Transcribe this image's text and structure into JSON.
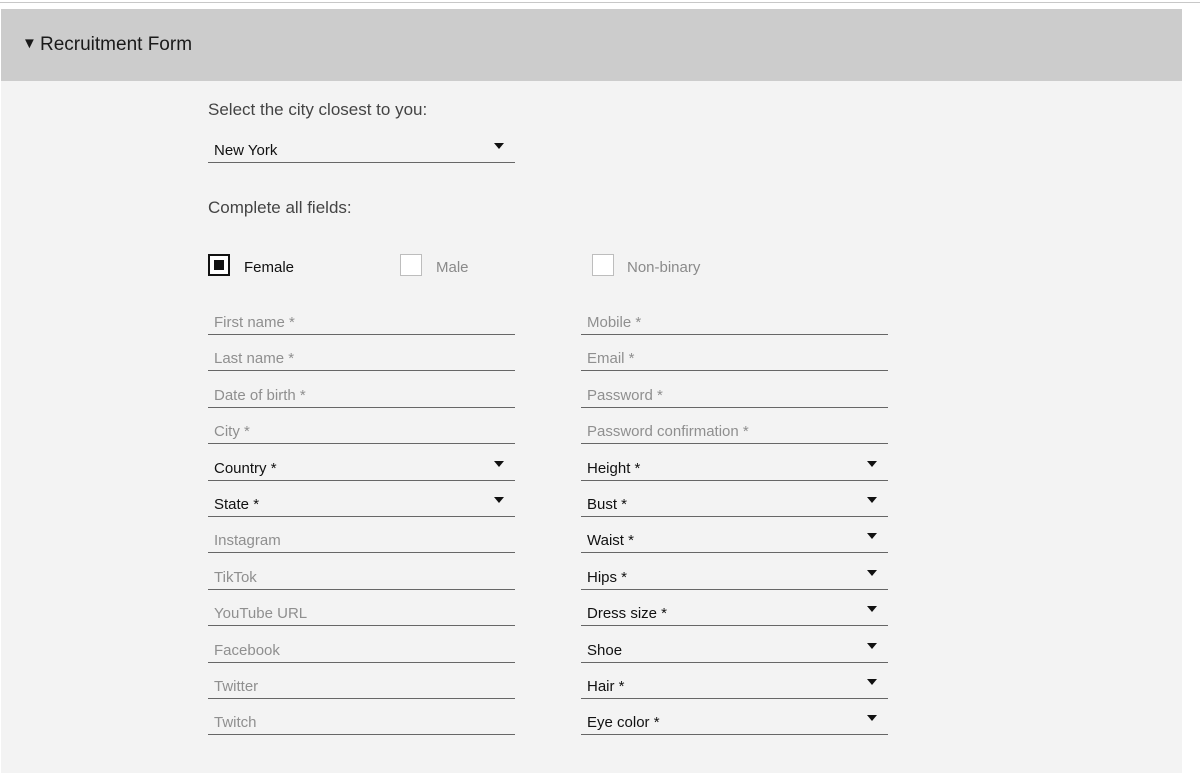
{
  "form": {
    "title": "Recruitment Form",
    "caret": "▼",
    "city_prompt": "Select the city closest to you:",
    "city_value": "New York",
    "complete_prompt": "Complete all fields:"
  },
  "gender": {
    "options": [
      {
        "label": "Female",
        "checked": true
      },
      {
        "label": "Male",
        "checked": false
      },
      {
        "label": "Non-binary",
        "checked": false
      }
    ]
  },
  "left_fields": [
    {
      "kind": "text",
      "placeholder": "First name *",
      "value": ""
    },
    {
      "kind": "text",
      "placeholder": "Last name *",
      "value": ""
    },
    {
      "kind": "text",
      "placeholder": "Date of birth *",
      "value": ""
    },
    {
      "kind": "text",
      "placeholder": "City *",
      "value": ""
    },
    {
      "kind": "select",
      "value": "Country *"
    },
    {
      "kind": "select",
      "value": "State *"
    },
    {
      "kind": "text",
      "placeholder": "Instagram",
      "value": ""
    },
    {
      "kind": "text",
      "placeholder": "TikTok",
      "value": ""
    },
    {
      "kind": "text",
      "placeholder": "YouTube URL",
      "value": ""
    },
    {
      "kind": "text",
      "placeholder": "Facebook",
      "value": ""
    },
    {
      "kind": "text",
      "placeholder": "Twitter",
      "value": ""
    },
    {
      "kind": "text",
      "placeholder": "Twitch",
      "value": ""
    }
  ],
  "right_fields": [
    {
      "kind": "text",
      "placeholder": "Mobile *",
      "value": ""
    },
    {
      "kind": "text",
      "placeholder": "Email *",
      "value": ""
    },
    {
      "kind": "text",
      "placeholder": "Password *",
      "value": ""
    },
    {
      "kind": "text",
      "placeholder": "Password confirmation *",
      "value": ""
    },
    {
      "kind": "select",
      "value": "Height *"
    },
    {
      "kind": "select",
      "value": "Bust *"
    },
    {
      "kind": "select",
      "value": "Waist *"
    },
    {
      "kind": "select",
      "value": "Hips *"
    },
    {
      "kind": "select",
      "value": "Dress size *"
    },
    {
      "kind": "select",
      "value": "Shoe"
    },
    {
      "kind": "select",
      "value": "Hair *"
    },
    {
      "kind": "select",
      "value": "Eye color *"
    }
  ]
}
